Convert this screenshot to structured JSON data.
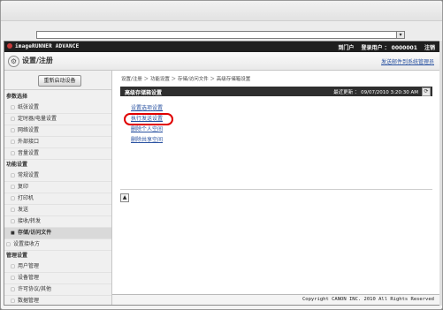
{
  "browser": {
    "address_dropdown_icon": "chevron-down-icon"
  },
  "header": {
    "brand": "imageRUNNER ADVANCE",
    "top_links": [
      "到门户",
      "登录用户 ： 0000001",
      "注销"
    ],
    "page_title": "设置/注册",
    "send_link": "发送邮件到系统管理员"
  },
  "sidebar": {
    "restart_label": "重新启动设备",
    "categories": [
      {
        "label": "参数选择",
        "items": [
          "纸张设置",
          "定时器/电量设置",
          "网络设置",
          "外部接口",
          "音量设置"
        ]
      },
      {
        "label": "功能设置",
        "items": [
          "常规设置",
          "复印",
          "打印机",
          "发送",
          "接收/转发",
          "存储/访问文件"
        ]
      },
      {
        "label": "设置接收方",
        "items": []
      },
      {
        "label": "管理设置",
        "items": [
          "用户管理",
          "设备管理",
          "许可协议/其他",
          "数据管理"
        ]
      }
    ]
  },
  "main": {
    "breadcrumb": "设置/注册 ＞ 功能设置 ＞ 存储/访问文件 ＞ 高级存储箱设置",
    "panel_title": "高级存储箱设置",
    "last_updated": "最近更新 ： 09/07/2010 3:20:30 AM",
    "refresh_icon": "refresh-icon",
    "links": [
      "设置选项设置",
      "执行发送设置",
      "删除个人空间",
      "删除共享空间"
    ],
    "back_to_top_icon": "back-to-top-icon"
  },
  "footer": {
    "copyright": "Copyright CANON INC. 2010 All Rights Reserved"
  }
}
